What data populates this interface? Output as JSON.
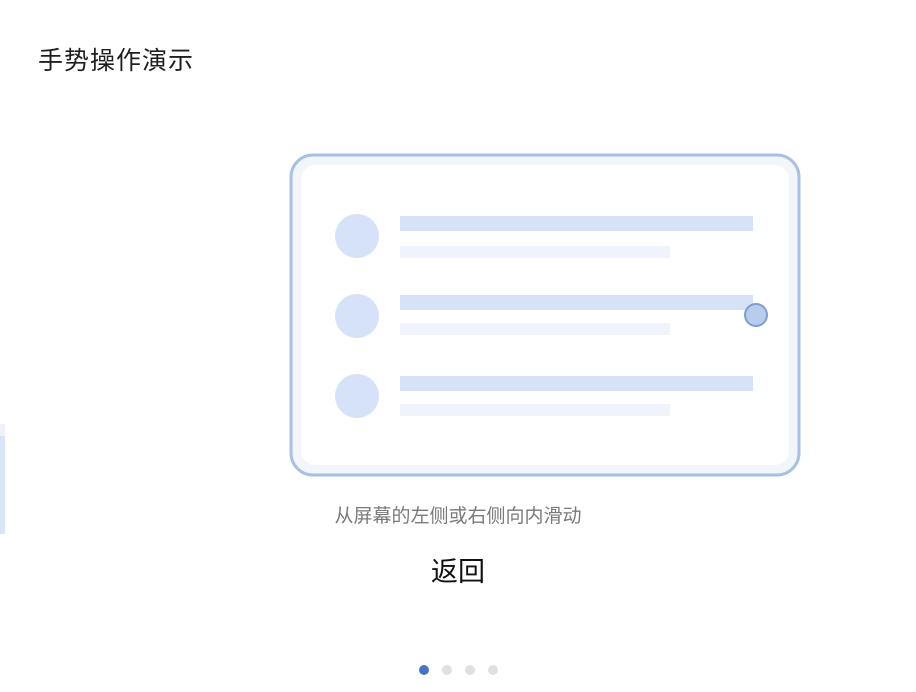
{
  "header": {
    "title": "手势操作演示"
  },
  "illustration": {
    "icon": "swipe-gesture-illustration",
    "frame_color": "#a7c0e4",
    "accent_color": "#d6e2f8",
    "light_color": "#eef3fc",
    "touch_color": "#b8ccec"
  },
  "instruction": {
    "text": "从屏幕的左侧或右侧向内滑动"
  },
  "actions": {
    "back_label": "返回"
  },
  "pagination": {
    "total": 4,
    "active_index": 0,
    "active_color": "#4a72c4",
    "inactive_color": "#e0e0e0"
  }
}
